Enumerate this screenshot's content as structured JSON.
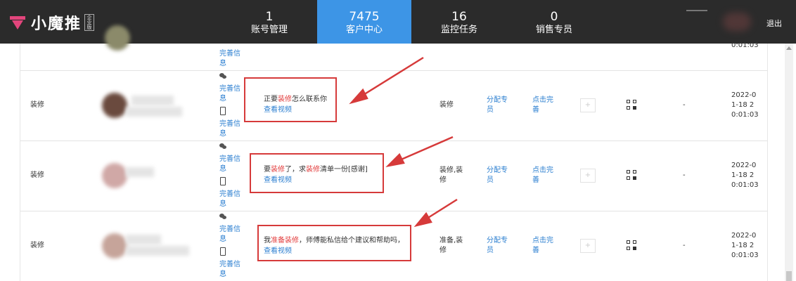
{
  "brand": {
    "name": "小魔推",
    "badge": "企业版"
  },
  "nav": [
    {
      "count": "1",
      "label": "账号管理",
      "active": false
    },
    {
      "count": "7475",
      "label": "客户中心",
      "active": true
    },
    {
      "count": "16",
      "label": "监控任务",
      "active": false
    },
    {
      "count": "0",
      "label": "销售专员",
      "active": false
    }
  ],
  "header": {
    "logout": "退出"
  },
  "top_partial": {
    "link_a": "完善信",
    "link_b": "息",
    "time_line3": "0:01:03"
  },
  "rows": [
    {
      "industry": "装修",
      "contact_link1_a": "完善信",
      "contact_link1_b": "息",
      "contact_link2_a": "完善信",
      "contact_link2_b": "息",
      "msg_pre": "正要",
      "msg_kw": "装修",
      "msg_post": "怎么联系你",
      "view_video": "查看视频",
      "tags_l1": "装修",
      "tags_l2": "",
      "assign_l1": "分配专",
      "assign_l2": "员",
      "complete_l1": "点击完",
      "complete_l2": "善",
      "plus": "+",
      "dash": "-",
      "time_l1": "2022-0",
      "time_l2": "1-18 2",
      "time_l3": "0:01:03"
    },
    {
      "industry": "装修",
      "contact_link1_a": "完善信",
      "contact_link1_b": "息",
      "contact_link2_a": "完善信",
      "contact_link2_b": "息",
      "msg_pre": "要",
      "msg_kw": "装修",
      "msg_mid": "了，求",
      "msg_kw2": "装修",
      "msg_post": "清单一份[感谢]",
      "view_video": "查看视频",
      "tags_l1": "装修,装",
      "tags_l2": "修",
      "assign_l1": "分配专",
      "assign_l2": "员",
      "complete_l1": "点击完",
      "complete_l2": "善",
      "plus": "+",
      "dash": "-",
      "time_l1": "2022-0",
      "time_l2": "1-18 2",
      "time_l3": "0:01:03"
    },
    {
      "industry": "装修",
      "contact_link1_a": "完善信",
      "contact_link1_b": "息",
      "contact_link2_a": "完善信",
      "contact_link2_b": "息",
      "msg_pre": "我",
      "msg_kw": "准备装修",
      "msg_post": "，师傅能私信给个建议和帮助吗，",
      "view_video": "查看视频",
      "tags_l1": "准备,装",
      "tags_l2": "修",
      "assign_l1": "分配专",
      "assign_l2": "员",
      "complete_l1": "点击完",
      "complete_l2": "善",
      "plus": "+",
      "dash": "-",
      "time_l1": "2022-0",
      "time_l2": "1-18 2",
      "time_l3": "0:01:03"
    }
  ],
  "colors": {
    "accent": "#3d95e6",
    "brand": "#e2457c",
    "highlight": "#d63a3a",
    "link": "#2c7fd0"
  }
}
